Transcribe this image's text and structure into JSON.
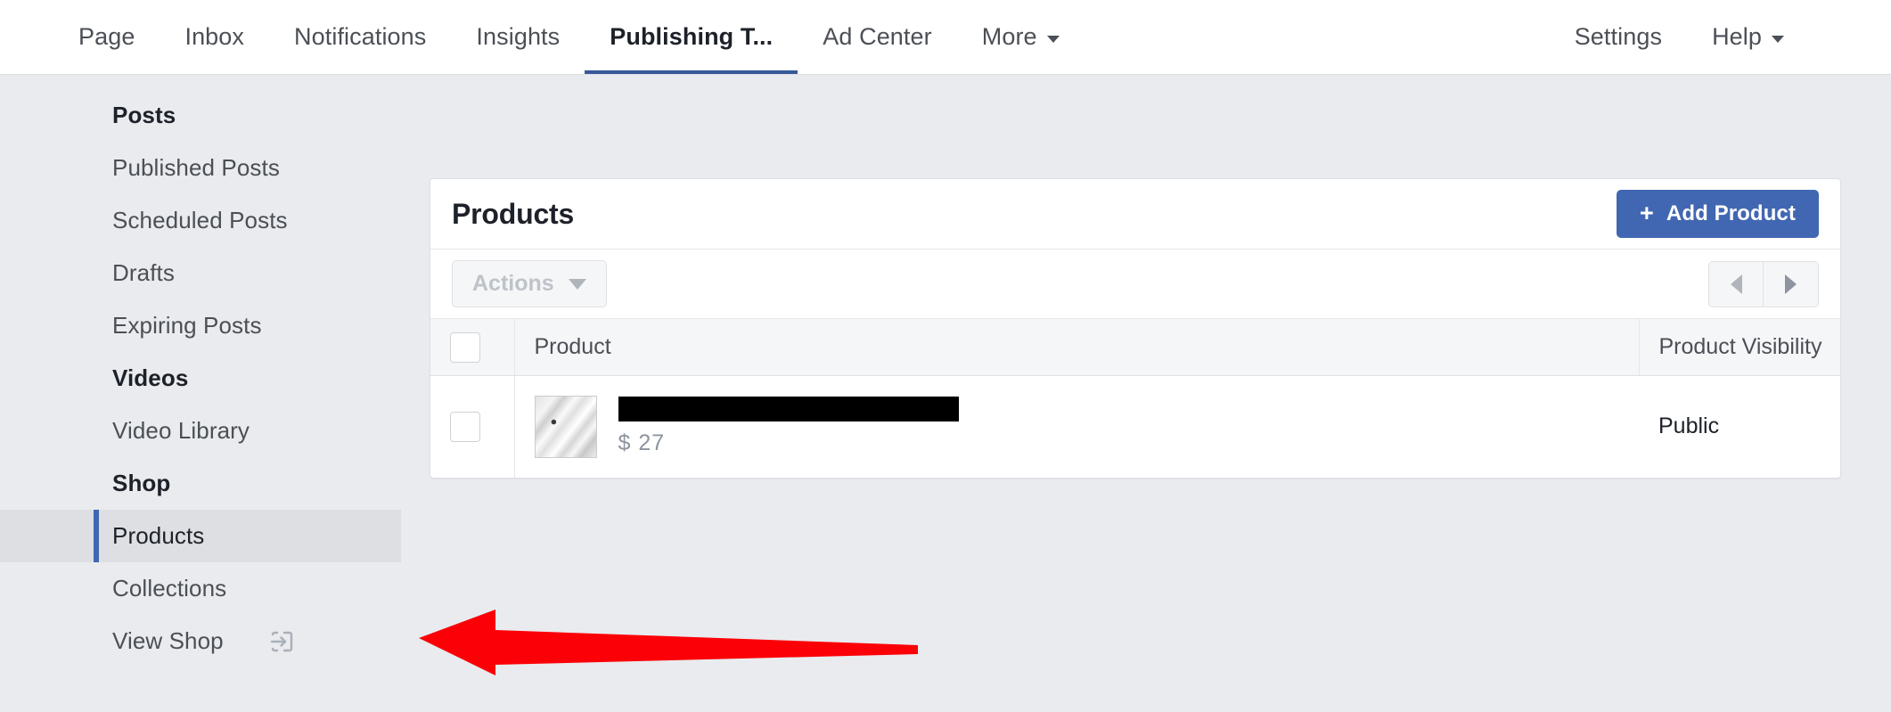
{
  "topnav": {
    "left_items": [
      {
        "label": "Page",
        "active": false,
        "caret": false
      },
      {
        "label": "Inbox",
        "active": false,
        "caret": false
      },
      {
        "label": "Notifications",
        "active": false,
        "caret": false
      },
      {
        "label": "Insights",
        "active": false,
        "caret": false
      },
      {
        "label": "Publishing T...",
        "active": true,
        "caret": false
      },
      {
        "label": "Ad Center",
        "active": false,
        "caret": false
      },
      {
        "label": "More",
        "active": false,
        "caret": true
      }
    ],
    "right_items": [
      {
        "label": "Settings",
        "caret": false
      },
      {
        "label": "Help",
        "caret": true
      }
    ]
  },
  "sidebar": {
    "groups": [
      {
        "title": "Posts",
        "items": [
          {
            "label": "Published Posts",
            "selected": false,
            "icon": null
          },
          {
            "label": "Scheduled Posts",
            "selected": false,
            "icon": null
          },
          {
            "label": "Drafts",
            "selected": false,
            "icon": null
          },
          {
            "label": "Expiring Posts",
            "selected": false,
            "icon": null
          }
        ]
      },
      {
        "title": "Videos",
        "items": [
          {
            "label": "Video Library",
            "selected": false,
            "icon": null
          }
        ]
      },
      {
        "title": "Shop",
        "items": [
          {
            "label": "Products",
            "selected": true,
            "icon": null
          },
          {
            "label": "Collections",
            "selected": false,
            "icon": null
          },
          {
            "label": "View Shop",
            "selected": false,
            "icon": "external-link-icon"
          }
        ]
      }
    ]
  },
  "card": {
    "title": "Products",
    "add_button": {
      "label": "Add Product",
      "icon": "plus-icon"
    },
    "toolbar": {
      "actions_label": "Actions",
      "actions_disabled": true,
      "prev_icon": "triangle-left-icon",
      "next_icon": "triangle-right-icon"
    },
    "table": {
      "columns": [
        "",
        "Product",
        "Product Visibility"
      ],
      "rows": [
        {
          "checked": false,
          "thumbnail": "product-photo-greyscale",
          "name": "",
          "name_redacted": true,
          "price": "$ 27",
          "visibility": "Public"
        }
      ]
    }
  },
  "annotation": {
    "arrow": {
      "color": "#fb0007",
      "direction": "left",
      "name": "red-arrow-pointing-to-products"
    }
  },
  "colors": {
    "accent_blue": "#4267b2",
    "active_tab_underline": "#365899",
    "page_background": "#e9ebee",
    "card_background": "#ffffff",
    "selected_item_background": "#dddfe2",
    "arrow_red": "#fb0007"
  }
}
